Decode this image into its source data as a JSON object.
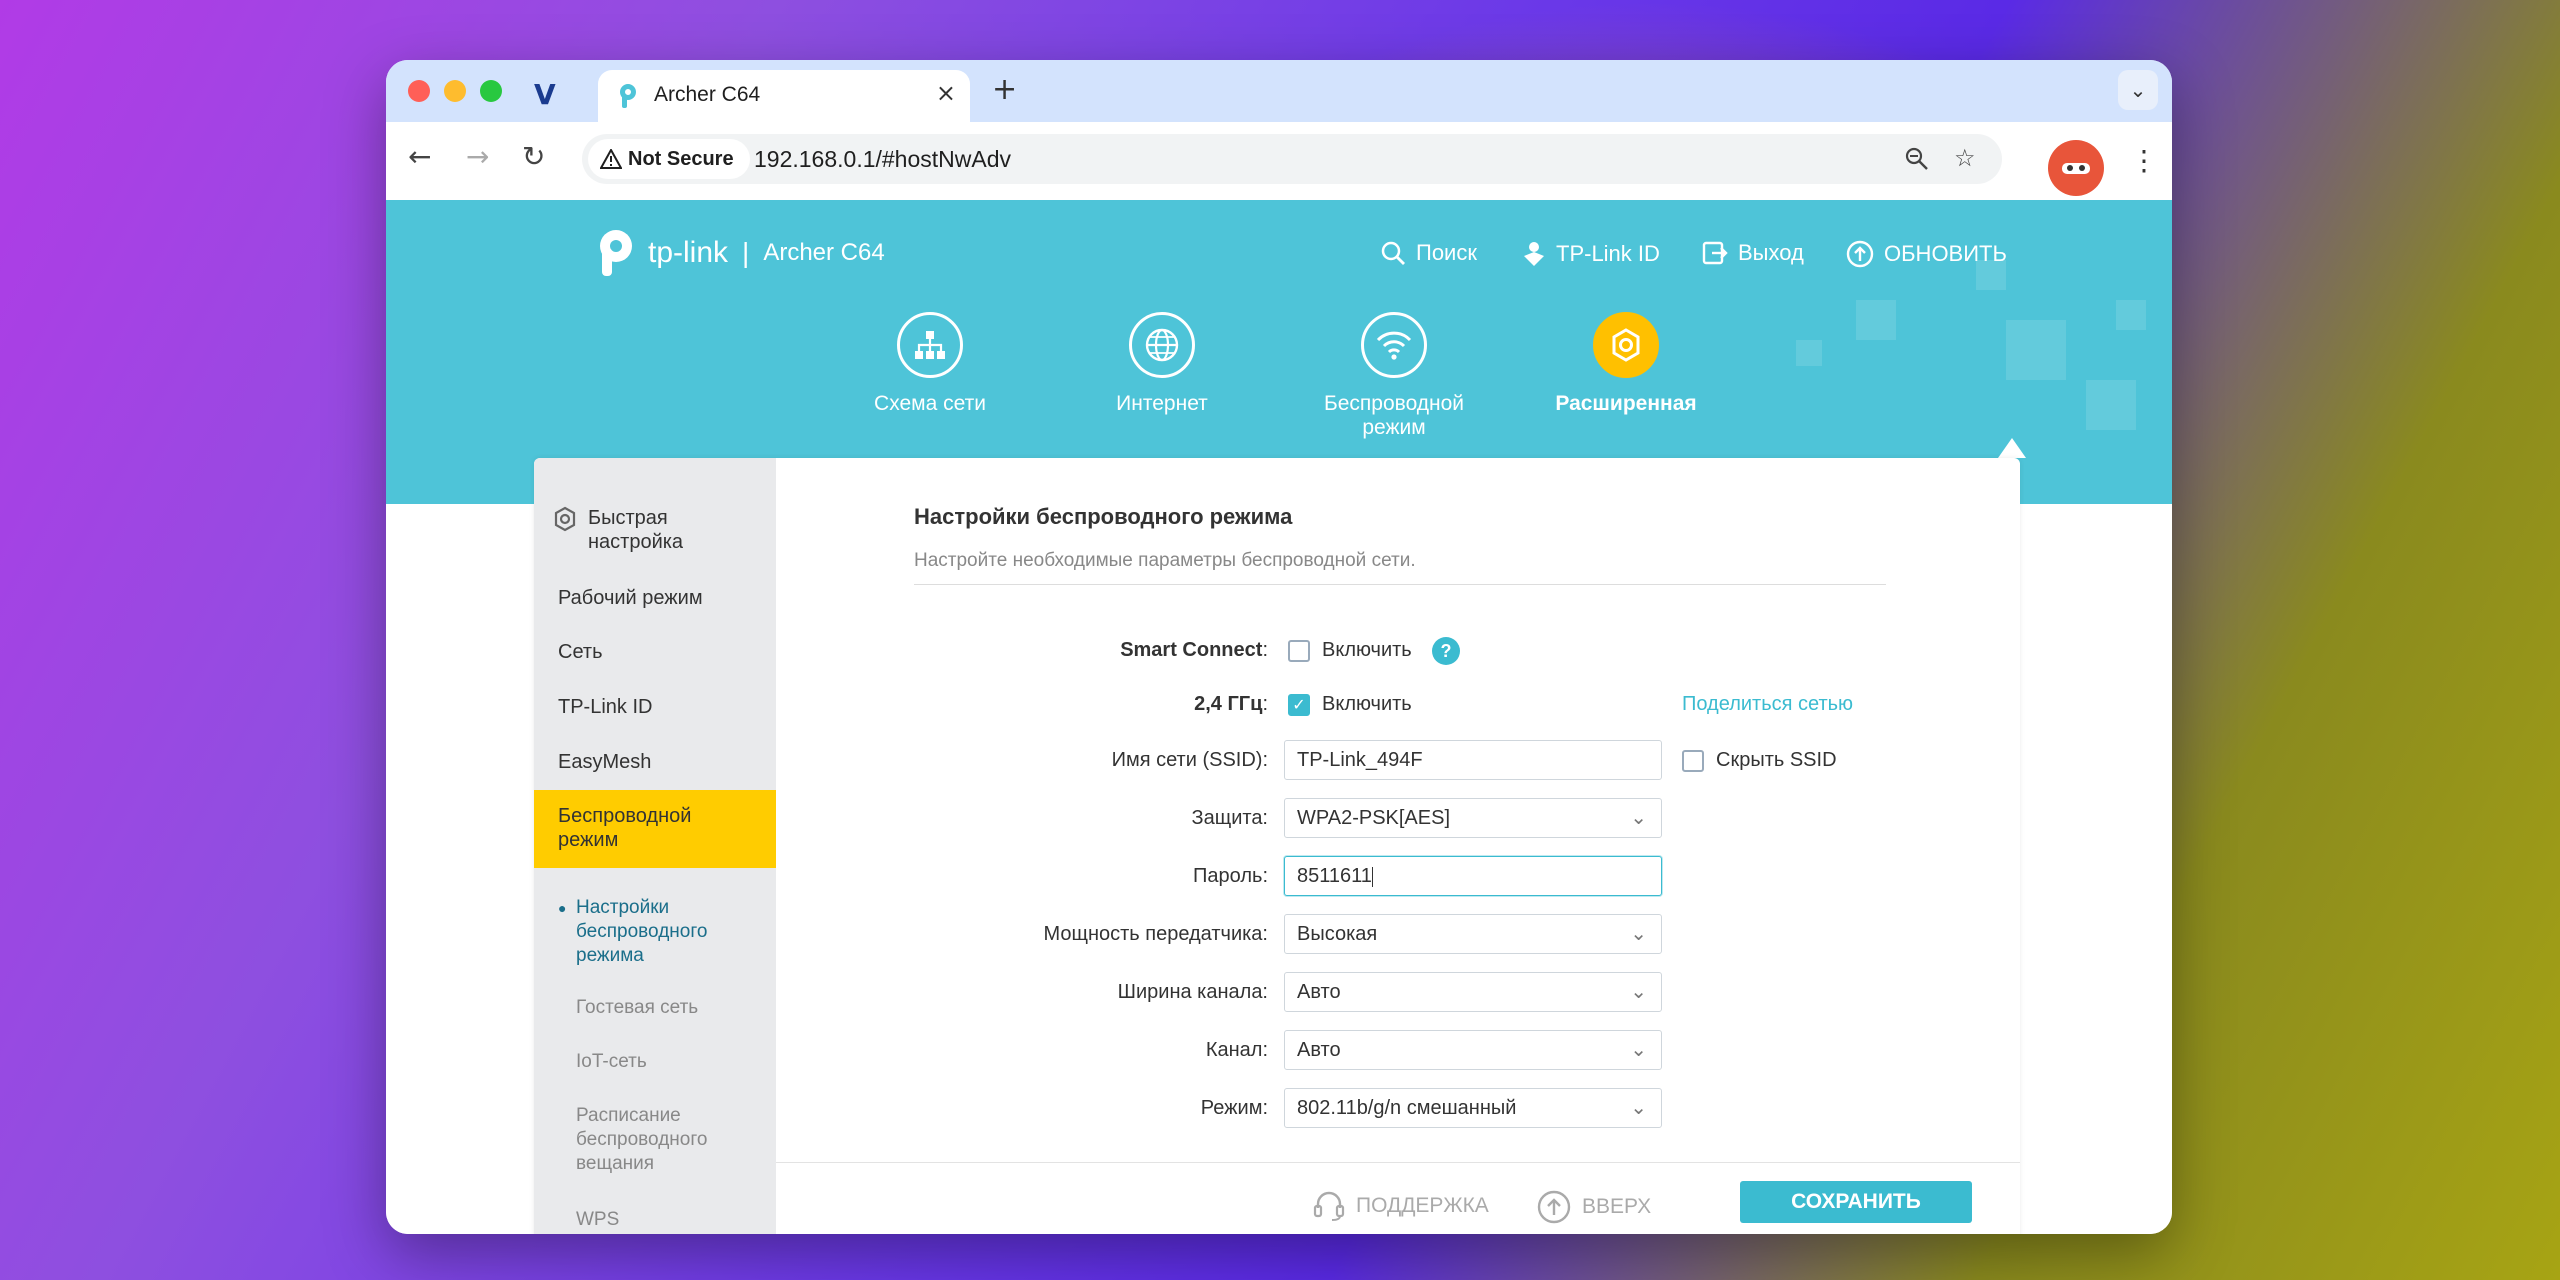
{
  "browser": {
    "tab_title": "Archer C64",
    "tab_close": "×",
    "new_tab": "+",
    "tab_menu": "⌄",
    "not_secure": "Not Secure",
    "url": "192.168.0.1/#hostNwAdv",
    "icons": [
      "back-icon",
      "forward-icon",
      "reload-icon",
      "zoom-icon",
      "bookmark-star-icon",
      "kebab-menu-icon"
    ]
  },
  "header": {
    "brand": "tp-link",
    "separator": "|",
    "model": "Archer C64",
    "nav": {
      "search": "Поиск",
      "tplink_id": "TP-Link ID",
      "logout": "Выход",
      "update": "ОБНОВИТЬ"
    }
  },
  "main_tabs": [
    {
      "label": "Схема сети",
      "icon": "network-map-icon"
    },
    {
      "label": "Интернет",
      "icon": "globe-icon"
    },
    {
      "label": "Беспроводной режим",
      "icon": "wifi-icon"
    },
    {
      "label": "Расширенная",
      "icon": "gear-icon",
      "active": true
    }
  ],
  "sidebar": {
    "items": [
      {
        "label": "Быстрая настройка"
      },
      {
        "label": "Рабочий режим"
      },
      {
        "label": "Сеть"
      },
      {
        "label": "TP-Link ID"
      },
      {
        "label": "EasyMesh"
      },
      {
        "label": "Беспроводной режим",
        "active": true
      }
    ],
    "sub_items": [
      {
        "label": "Настройки беспроводного режима",
        "active": true
      },
      {
        "label": "Гостевая сеть"
      },
      {
        "label": "IoT-сеть"
      },
      {
        "label": "Расписание беспроводного вещания"
      },
      {
        "label": "WPS"
      }
    ]
  },
  "form": {
    "title": "Настройки беспроводного режима",
    "subtitle": "Настройте необходимые параметры беспроводной сети.",
    "smart_connect": {
      "label": "Smart Connect",
      "colon": ":",
      "checkbox": "Включить",
      "checked": false,
      "help": "?"
    },
    "band_24": {
      "label": "2,4 ГГц",
      "colon": ":",
      "checkbox": "Включить",
      "checked": true,
      "share": "Поделиться сетью"
    },
    "ssid": {
      "label": "Имя сети (SSID):",
      "value": "TP-Link_494F",
      "hide_label": "Скрыть SSID",
      "hide_checked": false
    },
    "security": {
      "label": "Защита:",
      "value": "WPA2-PSK[AES]"
    },
    "password": {
      "label": "Пароль:",
      "value": "8511611"
    },
    "tx_power": {
      "label": "Мощность передатчика:",
      "value": "Высокая"
    },
    "channel_width": {
      "label": "Ширина канала:",
      "value": "Авто"
    },
    "channel": {
      "label": "Канал:",
      "value": "Авто"
    },
    "mode": {
      "label": "Режим:",
      "value": "802.11b/g/n смешанный"
    }
  },
  "footer": {
    "support": "ПОДДЕРЖКА",
    "up": "ВВЕРХ",
    "save": "СОХРАНИТЬ"
  },
  "colors": {
    "accent": "#4ec4d8",
    "active_yellow": "#ffcc00",
    "button": "#3bbbd0"
  }
}
